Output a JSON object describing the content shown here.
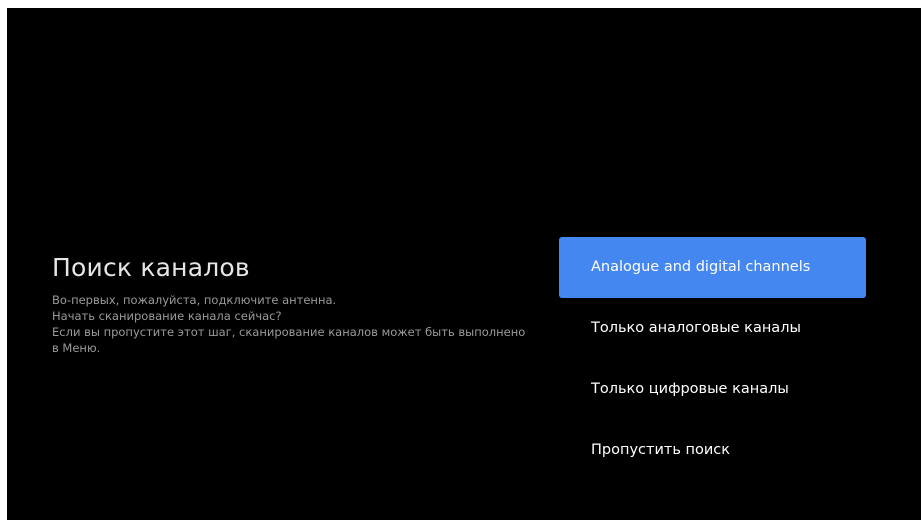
{
  "screen": {
    "title": "Поиск каналов",
    "description_lines": [
      "Во-первых, пожалуйста, подключите антенна.",
      "Начать сканирование канала сейчас?",
      "Если вы пропустите этот шаг, сканирование каналов может быть выполнено",
      "в Меню."
    ]
  },
  "menu": {
    "items": [
      {
        "label": "Analogue and digital channels",
        "selected": true
      },
      {
        "label": "Только аналоговые каналы",
        "selected": false
      },
      {
        "label": "Только цифровые каналы",
        "selected": false
      },
      {
        "label": "Пропустить поиск",
        "selected": false
      }
    ]
  },
  "colors": {
    "background": "#000000",
    "accent": "#4587f0",
    "title_text": "#e6e6e6",
    "body_text": "#9a9a9a",
    "menu_text": "#ffffff"
  }
}
